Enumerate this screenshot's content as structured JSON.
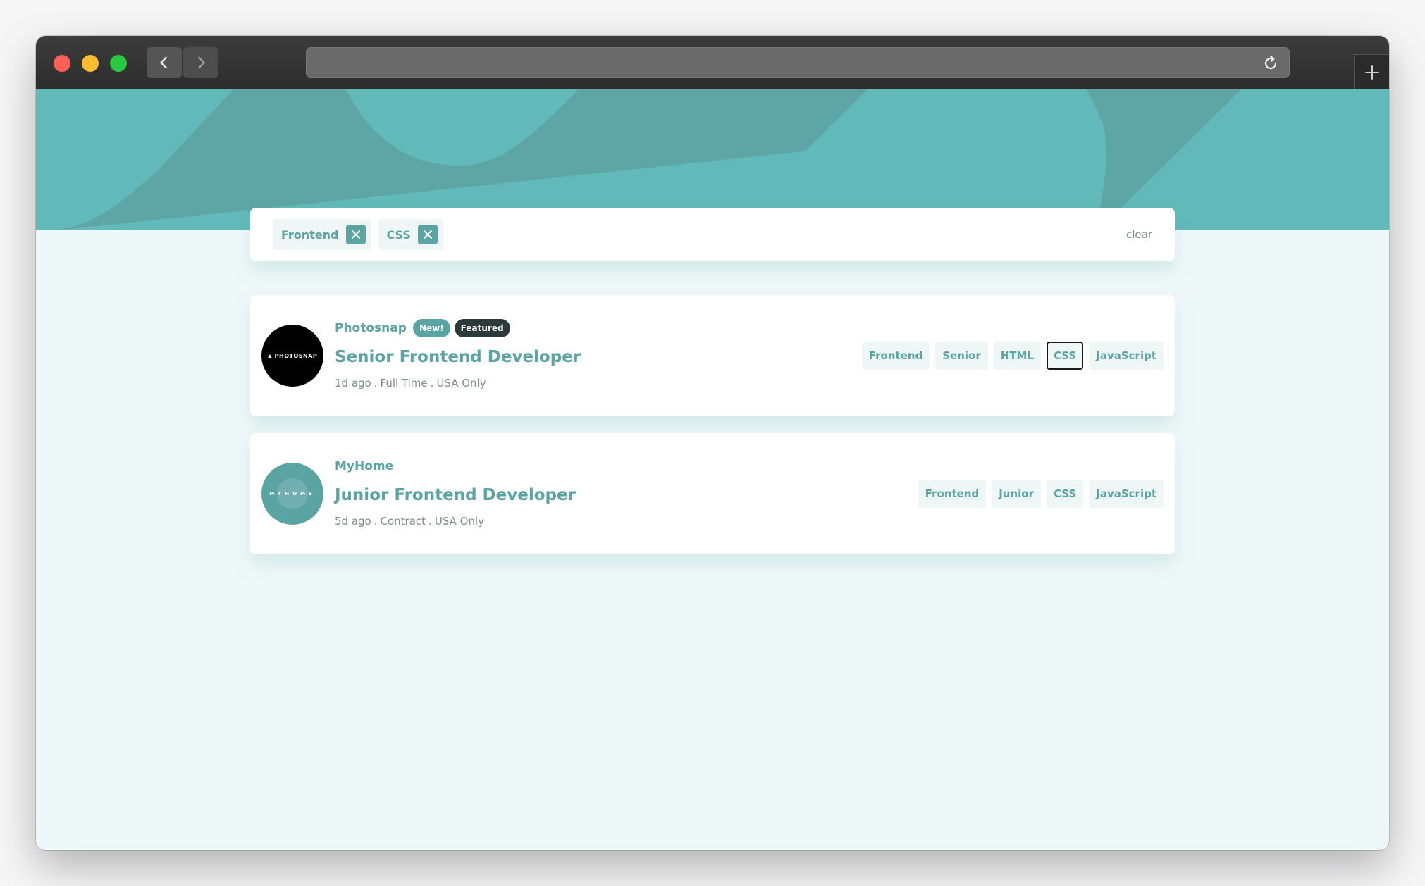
{
  "filters": {
    "active": [
      "Frontend",
      "CSS"
    ],
    "clear_label": "clear"
  },
  "jobs": [
    {
      "company": "Photosnap",
      "logo_text": "▲ PHOTOSNAP",
      "badge_new": "New!",
      "badge_featured": "Featured",
      "position": "Senior Frontend Developer",
      "posted": "1d ago",
      "contract": "Full Time",
      "location": "USA Only",
      "tags": [
        "Frontend",
        "Senior",
        "HTML",
        "CSS",
        "JavaScript"
      ],
      "focused_tag": "CSS"
    },
    {
      "company": "MyHome",
      "logo_text": "MYHOME",
      "position": "Junior Frontend Developer",
      "posted": "5d ago",
      "contract": "Contract",
      "location": "USA Only",
      "tags": [
        "Frontend",
        "Junior",
        "CSS",
        "JavaScript"
      ]
    }
  ],
  "meta_separator": ".",
  "icons": {
    "back": "chevron-left-icon",
    "forward": "chevron-right-icon",
    "reload": "reload-icon",
    "new_tab": "plus-icon",
    "remove_filter": "close-icon"
  },
  "colors": {
    "primary": "#5ba4a4",
    "hero": "#62b9ba",
    "background": "#eff8f8",
    "chip_background": "#eef6f6",
    "featured": "#2c3a3a",
    "meta_text": "#7b8e8e"
  }
}
